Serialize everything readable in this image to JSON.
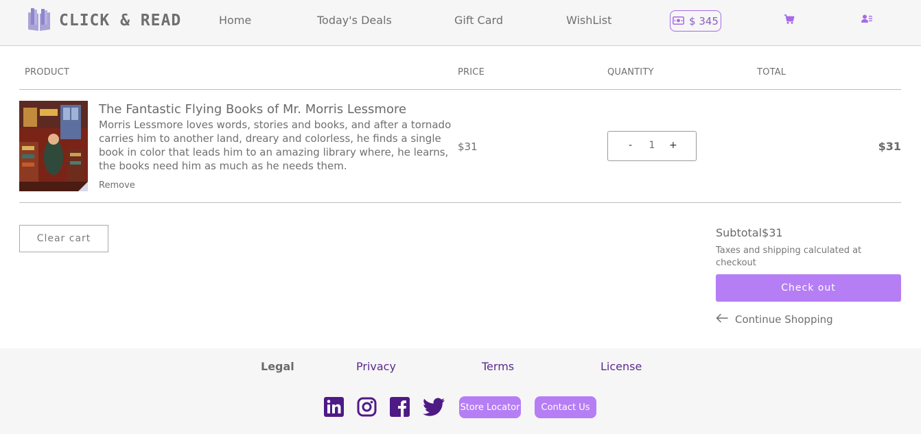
{
  "header": {
    "logo_text": "CLICK & READ",
    "nav": [
      "Home",
      "Today's Deals",
      "Gift Card",
      "WishList"
    ],
    "wallet_balance": "$ 345",
    "icons": [
      "book-logo-icon",
      "money-icon",
      "cart-icon",
      "user-list-icon"
    ]
  },
  "cart": {
    "columns": [
      "PRODUCT",
      "PRICE",
      "QUANTITY",
      "TOTAL"
    ],
    "items": [
      {
        "title": "The Fantastic Flying Books of Mr. Morris Lessmore",
        "description": "Morris Lessmore loves words, stories and books, and after a tornado carries him to another land, dreary and colorless, he finds a single book in color that leads him to an amazing library where, he learns, the books need him as much as he needs them.",
        "remove_label": "Remove",
        "price": "$31",
        "quantity": "1",
        "minus": "-",
        "plus": "+",
        "total": "$31"
      }
    ],
    "clear_label": "Clear cart",
    "subtotal": "Subtotal$31",
    "tax_note": "Taxes and shipping calculated at checkout",
    "checkout_label": "Check out",
    "continue_label": "Continue Shopping"
  },
  "footer": {
    "legal": "Legal",
    "links": [
      "Privacy",
      "Terms",
      "License"
    ],
    "social": [
      "linkedin-icon",
      "instagram-icon",
      "facebook-icon",
      "twitter-icon"
    ],
    "store_locator": "Store Locator",
    "contact": "Contact Us"
  },
  "colors": {
    "accent": "#b67ef5",
    "accent_dark": "#5a2a8f",
    "header_bg": "#f6f6f6"
  }
}
